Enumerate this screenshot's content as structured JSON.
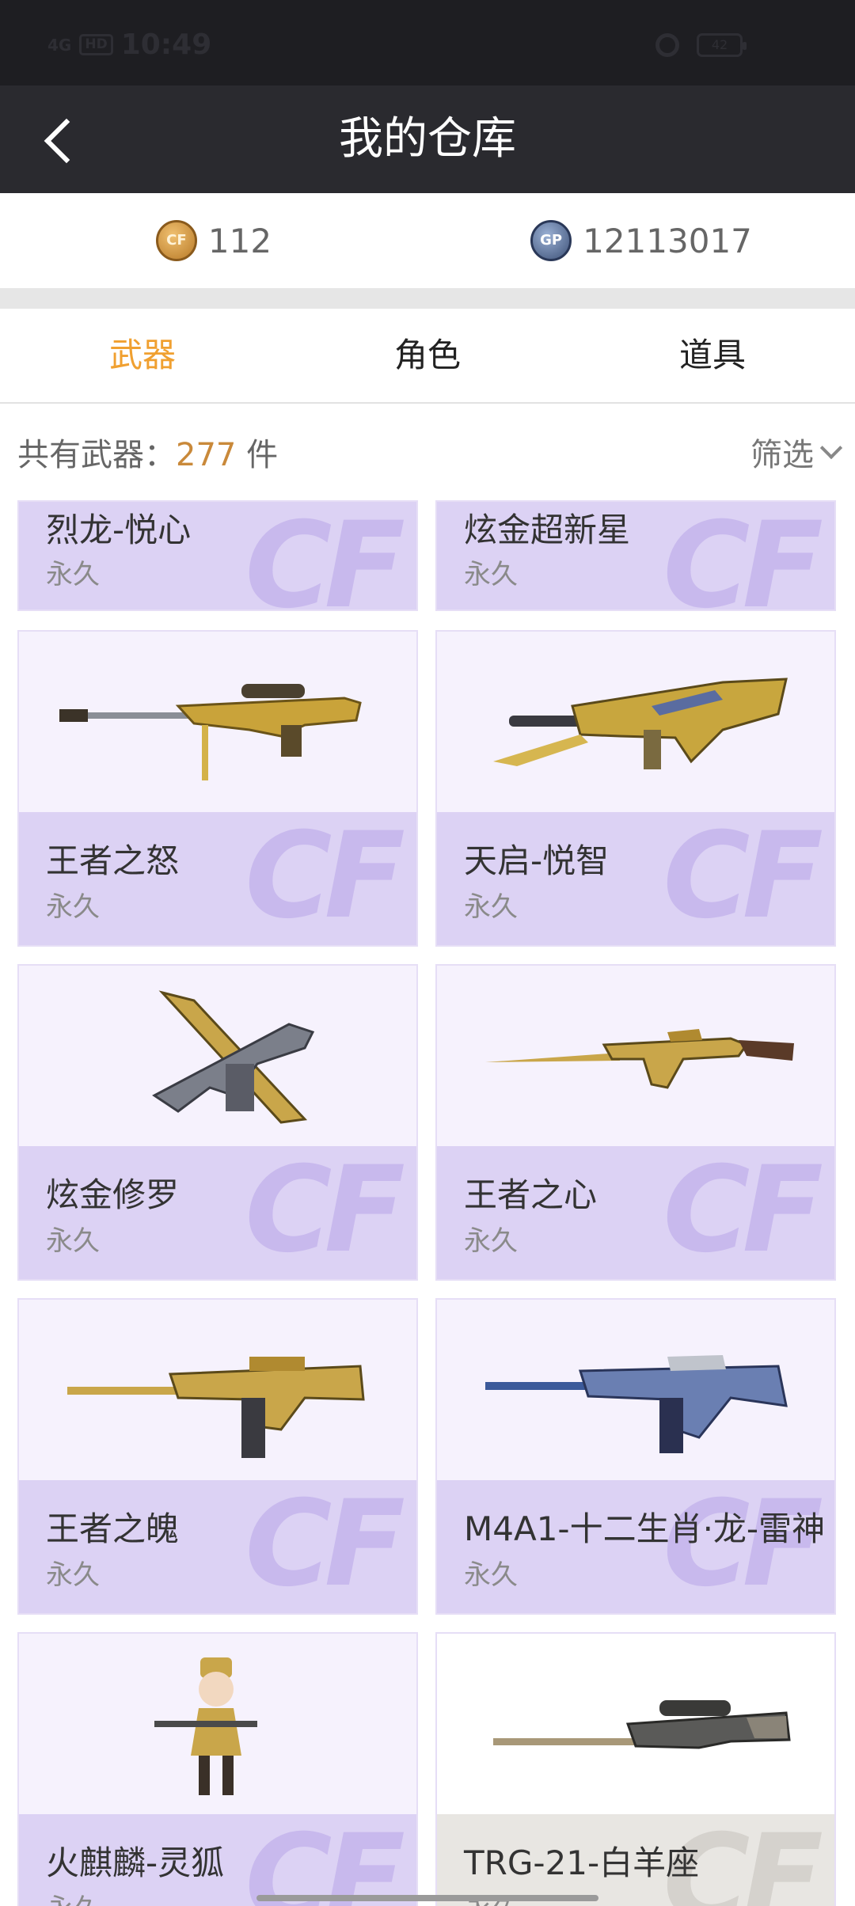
{
  "status_bar": {
    "network": "4G",
    "hd": "HD",
    "time": "10:49",
    "battery": "42"
  },
  "nav": {
    "title": "我的仓库"
  },
  "currency": {
    "cf_amount": "112",
    "gp_amount": "12113017"
  },
  "tabs": [
    {
      "label": "武器",
      "active": true
    },
    {
      "label": "角色",
      "active": false
    },
    {
      "label": "道具",
      "active": false
    }
  ],
  "summary": {
    "prefix": "共有武器：",
    "count": "277",
    "suffix": " 件",
    "filter_label": "筛选"
  },
  "items": [
    {
      "name": "烈龙-悦心",
      "duration": "永久",
      "icon": "weapon-icon"
    },
    {
      "name": "炫金超新星",
      "duration": "永久",
      "icon": "weapon-icon"
    },
    {
      "name": "王者之怒",
      "duration": "永久",
      "icon": "sniper-rifle-icon"
    },
    {
      "name": "天启-悦智",
      "duration": "永久",
      "icon": "assault-rifle-icon"
    },
    {
      "name": "炫金修罗",
      "duration": "永久",
      "icon": "pistol-blade-icon"
    },
    {
      "name": "王者之心",
      "duration": "永久",
      "icon": "ak-rifle-icon"
    },
    {
      "name": "王者之魄",
      "duration": "永久",
      "icon": "m4-rifle-icon"
    },
    {
      "name": "M4A1-十二生肖·龙-雷神",
      "duration": "永久",
      "icon": "m4-rifle-icon"
    },
    {
      "name": "火麒麟-灵狐",
      "duration": "永久",
      "icon": "character-rifle-icon"
    },
    {
      "name": "TRG-21-白羊座",
      "duration": "永久",
      "icon": "sniper-rifle-icon"
    }
  ],
  "colors": {
    "accent": "#f0a030",
    "count": "#c9893a",
    "card_info": "#dcd2f4",
    "card_thumb": "#f6f2fd",
    "navbar": "#2a2a2f"
  }
}
